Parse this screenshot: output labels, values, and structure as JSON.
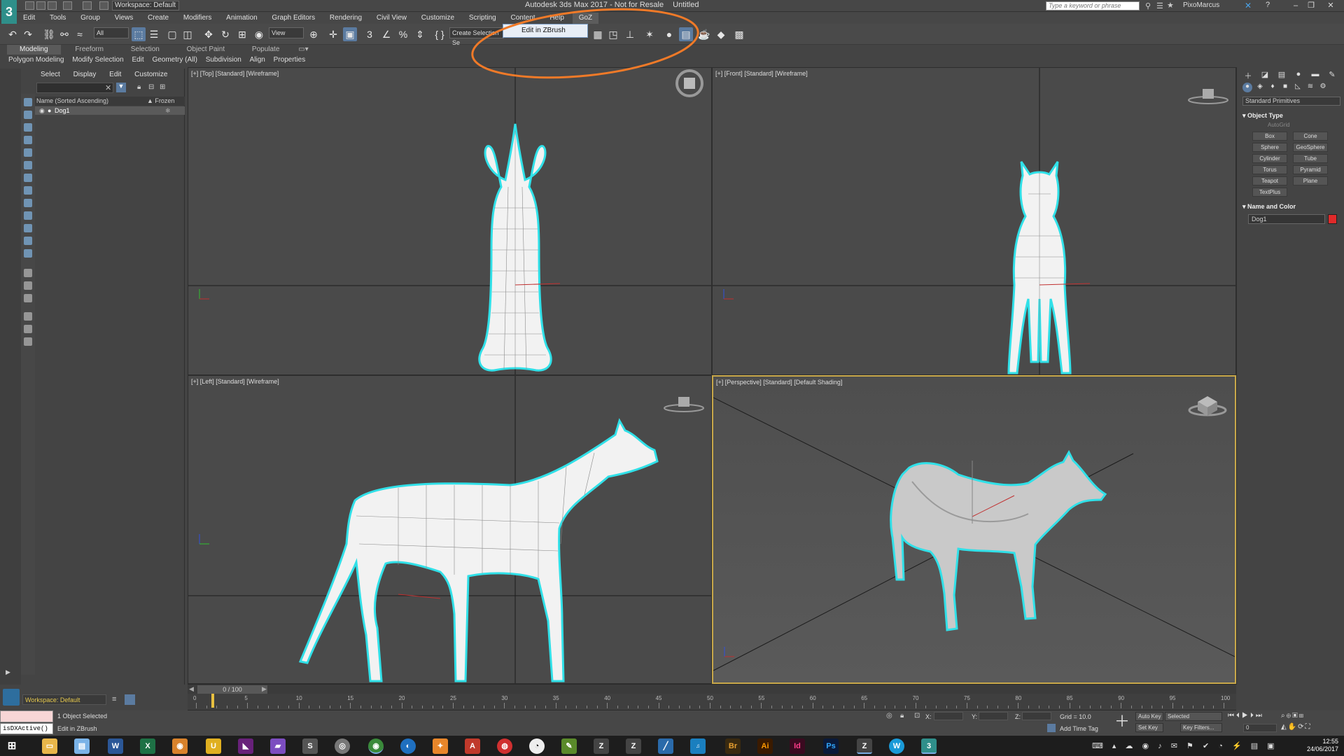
{
  "app": {
    "title": "Autodesk 3ds Max 2017 - Not for Resale",
    "file": "Untitled",
    "workspace": "Workspace: Default",
    "search_placeholder": "Type a keyword or phrase",
    "user": "PixoMarcus"
  },
  "menu": [
    "Edit",
    "Tools",
    "Group",
    "Views",
    "Create",
    "Modifiers",
    "Animation",
    "Graph Editors",
    "Rendering",
    "Civil View",
    "Customize",
    "Scripting",
    "Content",
    "Help",
    "GoZ"
  ],
  "toolbar": {
    "filter_all": "All",
    "ref_coord": "View",
    "named_sel": "Create Selection Se"
  },
  "goz_menu": {
    "item": "Edit in ZBrush"
  },
  "ribbon": {
    "tabs": [
      "Modeling",
      "Freeform",
      "Selection",
      "Object Paint",
      "Populate"
    ],
    "sub": [
      "Polygon Modeling",
      "Modify Selection",
      "Edit",
      "Geometry (All)",
      "Subdivision",
      "Align",
      "Properties"
    ]
  },
  "explorer": {
    "menu": [
      "Select",
      "Display",
      "Edit",
      "Customize"
    ],
    "col_name": "Name (Sorted Ascending)",
    "col_frozen": "▲ Frozen",
    "rows": [
      {
        "name": "Dog1"
      }
    ]
  },
  "viewports": {
    "top": "[+] [Top] [Standard] [Wireframe]",
    "front": "[+] [Front] [Standard] [Wireframe]",
    "left": "[+] [Left] [Standard] [Wireframe]",
    "perspective": "[+] [Perspective] [Standard] [Default Shading]"
  },
  "command_panel": {
    "category": "Standard Primitives",
    "object_type_title": "Object Type",
    "autogrid": "AutoGrid",
    "buttons": [
      "Box",
      "Cone",
      "Sphere",
      "GeoSphere",
      "Cylinder",
      "Tube",
      "Torus",
      "Pyramid",
      "Teapot",
      "Plane",
      "TextPlus"
    ],
    "name_color_title": "Name and Color",
    "object_name": "Dog1",
    "object_color": "#e02a2a"
  },
  "timeline": {
    "frame": "0 / 100",
    "ticks": [
      "0",
      "5",
      "10",
      "15",
      "20",
      "25",
      "30",
      "35",
      "40",
      "45",
      "50",
      "55",
      "60",
      "65",
      "70",
      "75",
      "80",
      "85",
      "90",
      "95",
      "100"
    ]
  },
  "status": {
    "selection": "1 Object Selected",
    "prompt": "Edit in ZBrush",
    "maxscript": "isDXActive()",
    "x_label": "X:",
    "y_label": "Y:",
    "z_label": "Z:",
    "grid": "Grid = 10.0",
    "add_time_tag": "Add Time Tag",
    "auto_key": "Auto Key",
    "set_key": "Set Key",
    "selected": "Selected",
    "key_filters": "Key Filters...",
    "frame_field": "0",
    "workspace_bottom": "Workspace: Default"
  },
  "taskbar": {
    "apps": [
      "Win",
      "Explorer",
      "Notes",
      "W",
      "X",
      "Hub",
      "U",
      "VS",
      "Fig",
      "S",
      "Disc",
      "Chrome",
      "Outlook",
      "Fox",
      "PDF",
      "Edge",
      "Steam",
      "Tool",
      "Z1",
      "Z2",
      "Pen",
      "Music",
      "Br",
      "Ai",
      "Id",
      "Ps",
      "ZB",
      "Wc",
      "3"
    ],
    "time": "12:55",
    "date": "24/06/2017"
  },
  "colors": {
    "wire_highlight": "#30e0e8",
    "annotation": "#f07a28",
    "perspective_border": "#c8a84a"
  }
}
